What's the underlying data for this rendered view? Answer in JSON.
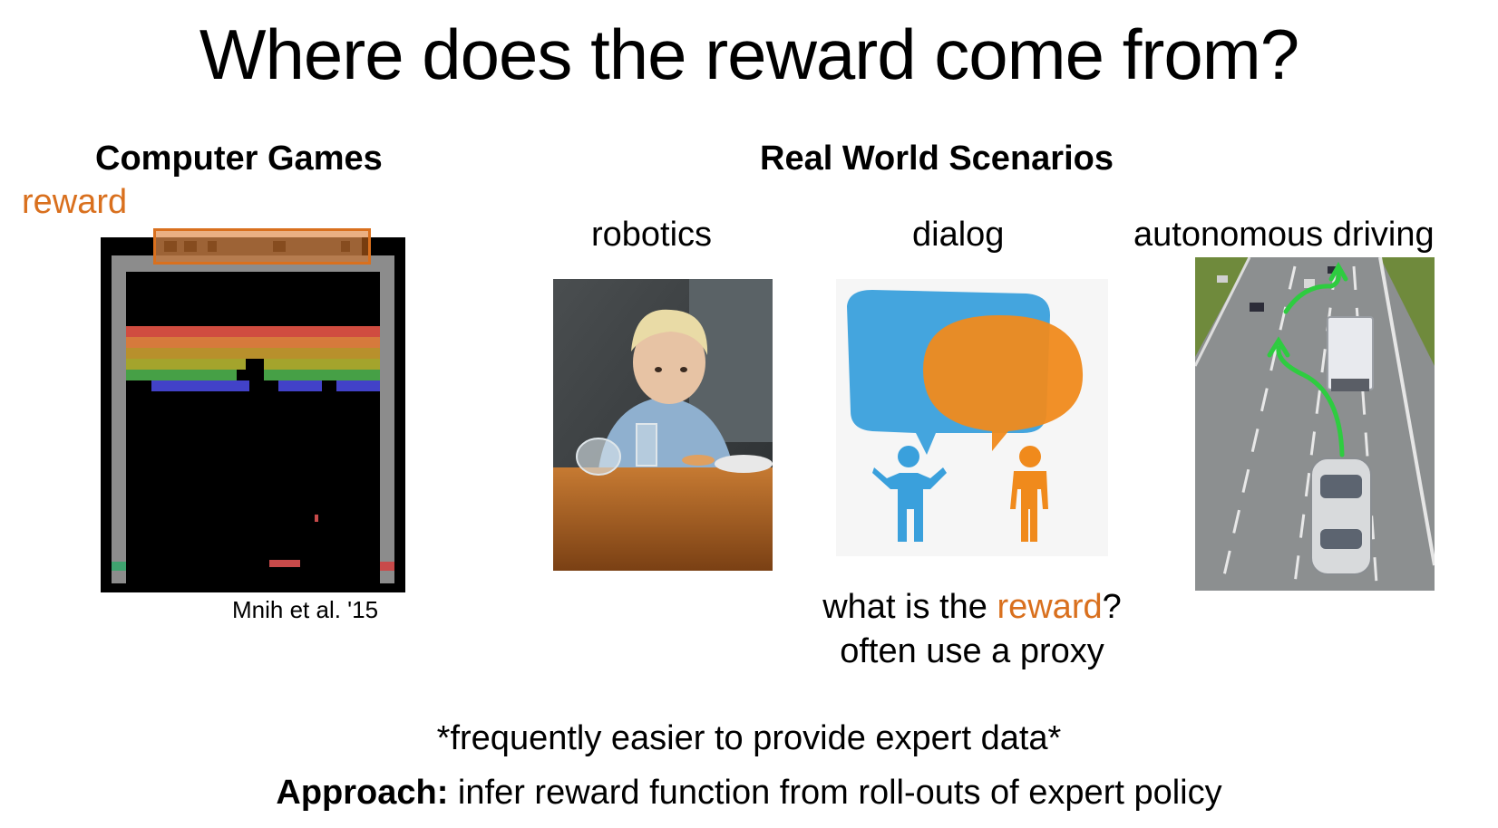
{
  "slide": {
    "title": "Where does the reward come from?"
  },
  "games": {
    "heading": "Computer Games",
    "reward_label": "reward",
    "citation": "Mnih et al. '15"
  },
  "real_world": {
    "heading": "Real World Scenarios",
    "robotics_label": "robotics",
    "dialog_label": "dialog",
    "driving_label": "autonomous driving",
    "question_prefix": "what is the ",
    "question_highlight": "reward",
    "question_suffix": "?",
    "proxy_note": "often use a proxy"
  },
  "footer": {
    "note": "*frequently easier to provide expert data*",
    "approach_label": "Approach:",
    "approach_text": " infer reward function from roll-outs of expert policy"
  },
  "colors": {
    "accent": "#d9701e",
    "dialog_blue": "#3aa0dc",
    "dialog_orange": "#f08a1c",
    "arrow_green": "#2ecc40"
  }
}
